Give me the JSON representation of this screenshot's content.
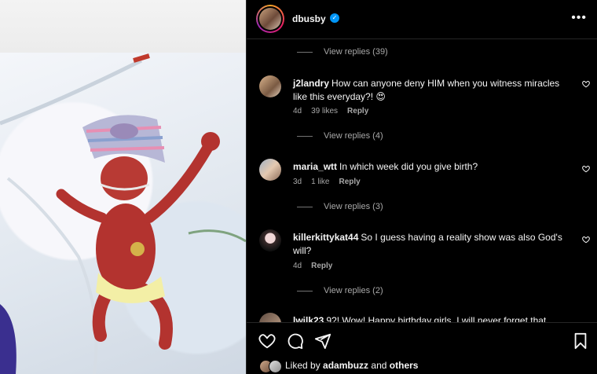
{
  "post": {
    "username": "dbusby",
    "more_icon": "more-horizontal-icon"
  },
  "comments": [
    {
      "type": "view_replies",
      "label": "View replies (39)"
    },
    {
      "type": "comment",
      "username": "j2landry",
      "text": "How can anyone deny HIM when you witness miracles like this everyday?! 😍",
      "age": "4d",
      "likes": "39 likes",
      "reply": "Reply"
    },
    {
      "type": "view_replies",
      "label": "View replies (4)"
    },
    {
      "type": "comment",
      "username": "maria_wtt",
      "text": "In which week did you give birth?",
      "age": "3d",
      "likes": "1 like",
      "reply": "Reply"
    },
    {
      "type": "view_replies",
      "label": "View replies (3)"
    },
    {
      "type": "comment",
      "username": "killerkittykat44",
      "text": "So I guess having a reality show was also God's will?",
      "age": "4d",
      "reply": "Reply"
    },
    {
      "type": "view_replies",
      "label": "View replies (2)"
    },
    {
      "type": "comment",
      "username": "lwilk23",
      "text": "9?! Wow! Happy birthday girls. I will never forget that"
    }
  ],
  "footer": {
    "liked_prefix": "Liked by",
    "liked_user": "adambuzz",
    "liked_and": "and",
    "liked_others": "others"
  },
  "colors": {
    "background": "#000000",
    "muted_text": "#a8a8a8",
    "verified": "#0095f6",
    "divider": "#262626"
  }
}
